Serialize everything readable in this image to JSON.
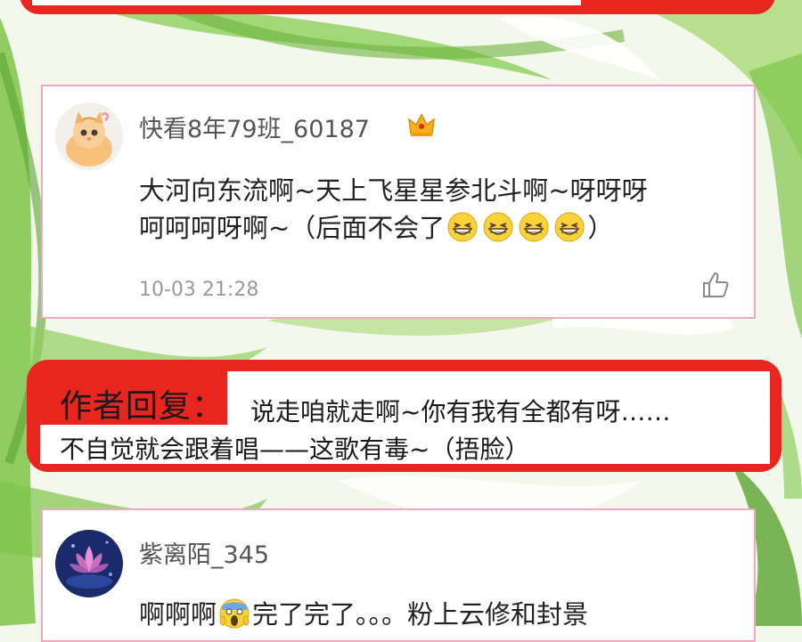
{
  "comments": [
    {
      "username": "快看8年79班_60187",
      "text_line1": "大河向东流啊~天上飞星星参北斗啊~呀呀呀",
      "text_line2_prefix": "呵呵呵呀啊~（后面不会了",
      "text_line2_suffix": "）",
      "timestamp": "10-03 21:28",
      "avatar_icon": "kitten-avatar",
      "badge_icon": "crown-icon",
      "emoji_icon": "grinning-squint-emoji"
    },
    {
      "username": "紫离陌_345",
      "text_prefix": "啊啊啊",
      "text_suffix": "完了完了。。。粉上云修和封景",
      "avatar_icon": "lotus-avatar",
      "emoji_icon": "screaming-emoji"
    }
  ],
  "author_reply": {
    "label": "作者回复：",
    "line1": "说走咱就走啊~你有我有全都有呀……",
    "line2": "不自觉就会跟着唱——这歌有毒~（捂脸）"
  },
  "colors": {
    "reply_red": "#e8261f",
    "card_border": "#f2a9bf",
    "leaf_green": "#6db33f"
  }
}
